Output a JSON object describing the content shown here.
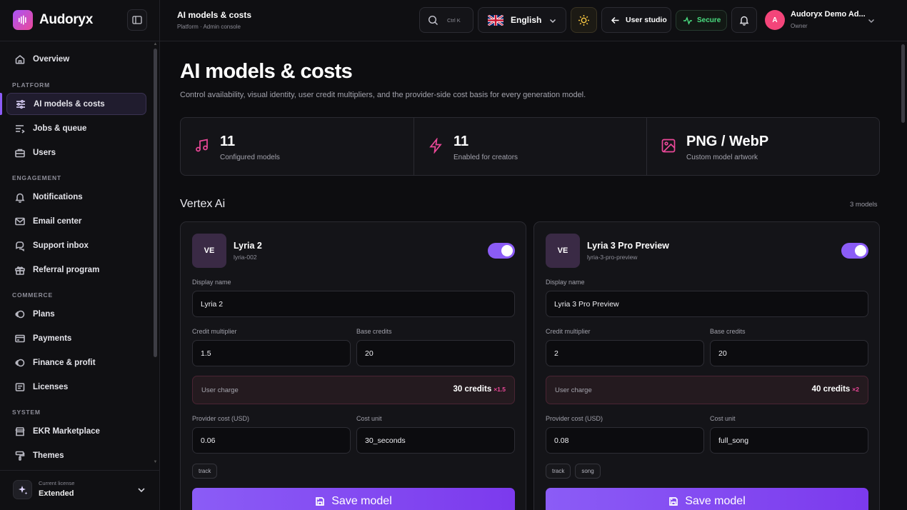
{
  "app": {
    "name": "Audoryx"
  },
  "sidebar": {
    "overview": "Overview",
    "sections": {
      "platform": "PLATFORM",
      "engagement": "ENGAGEMENT",
      "commerce": "COMMERCE",
      "system": "SYSTEM"
    },
    "items": {
      "ai_models": "AI models & costs",
      "jobs": "Jobs & queue",
      "users": "Users",
      "notifications": "Notifications",
      "email": "Email center",
      "support": "Support inbox",
      "referral": "Referral program",
      "plans": "Plans",
      "payments": "Payments",
      "finance": "Finance & profit",
      "licenses": "Licenses",
      "marketplace": "EKR Marketplace",
      "themes": "Themes"
    },
    "license": {
      "caption": "Current license",
      "value": "Extended"
    }
  },
  "header": {
    "title": "AI models & costs",
    "breadcrumb": "Platform · Admin console",
    "search_shortcut": "Ctrl K",
    "language": "English",
    "user_studio": "User studio",
    "secure": "Secure",
    "user": {
      "initial": "A",
      "name": "Audoryx Demo Ad...",
      "role": "Owner"
    }
  },
  "page": {
    "title": "AI models & costs",
    "subtitle": "Control availability, visual identity, user credit multipliers, and the provider-side cost basis for every generation model."
  },
  "stats": [
    {
      "value": "11",
      "caption": "Configured models",
      "icon": "music-note-icon"
    },
    {
      "value": "11",
      "caption": "Enabled for creators",
      "icon": "lightning-icon"
    },
    {
      "value": "PNG / WebP",
      "caption": "Custom model artwork",
      "icon": "image-icon"
    }
  ],
  "provider": {
    "name": "Vertex Ai",
    "count": "3 models"
  },
  "labels": {
    "display_name": "Display name",
    "credit_multiplier": "Credit multiplier",
    "base_credits": "Base credits",
    "user_charge": "User charge",
    "provider_cost": "Provider cost (USD)",
    "cost_unit": "Cost unit",
    "save": "Save model"
  },
  "models": [
    {
      "badge": "VE",
      "name": "Lyria 2",
      "code": "lyria-002",
      "enabled": true,
      "display_name": "Lyria 2",
      "credit_multiplier": "1.5",
      "base_credits": "20",
      "charge": "30 credits",
      "charge_mult": "×1.5",
      "provider_cost": "0.06",
      "cost_unit": "30_seconds",
      "tags": [
        "track"
      ]
    },
    {
      "badge": "VE",
      "name": "Lyria 3 Pro Preview",
      "code": "lyria-3-pro-preview",
      "enabled": true,
      "display_name": "Lyria 3 Pro Preview",
      "credit_multiplier": "2",
      "base_credits": "20",
      "charge": "40 credits",
      "charge_mult": "×2",
      "provider_cost": "0.08",
      "cost_unit": "full_song",
      "tags": [
        "track",
        "song"
      ]
    }
  ],
  "colors": {
    "accent": "#8b5cf6",
    "pink": "#ec4899",
    "secure": "#4ade80"
  }
}
